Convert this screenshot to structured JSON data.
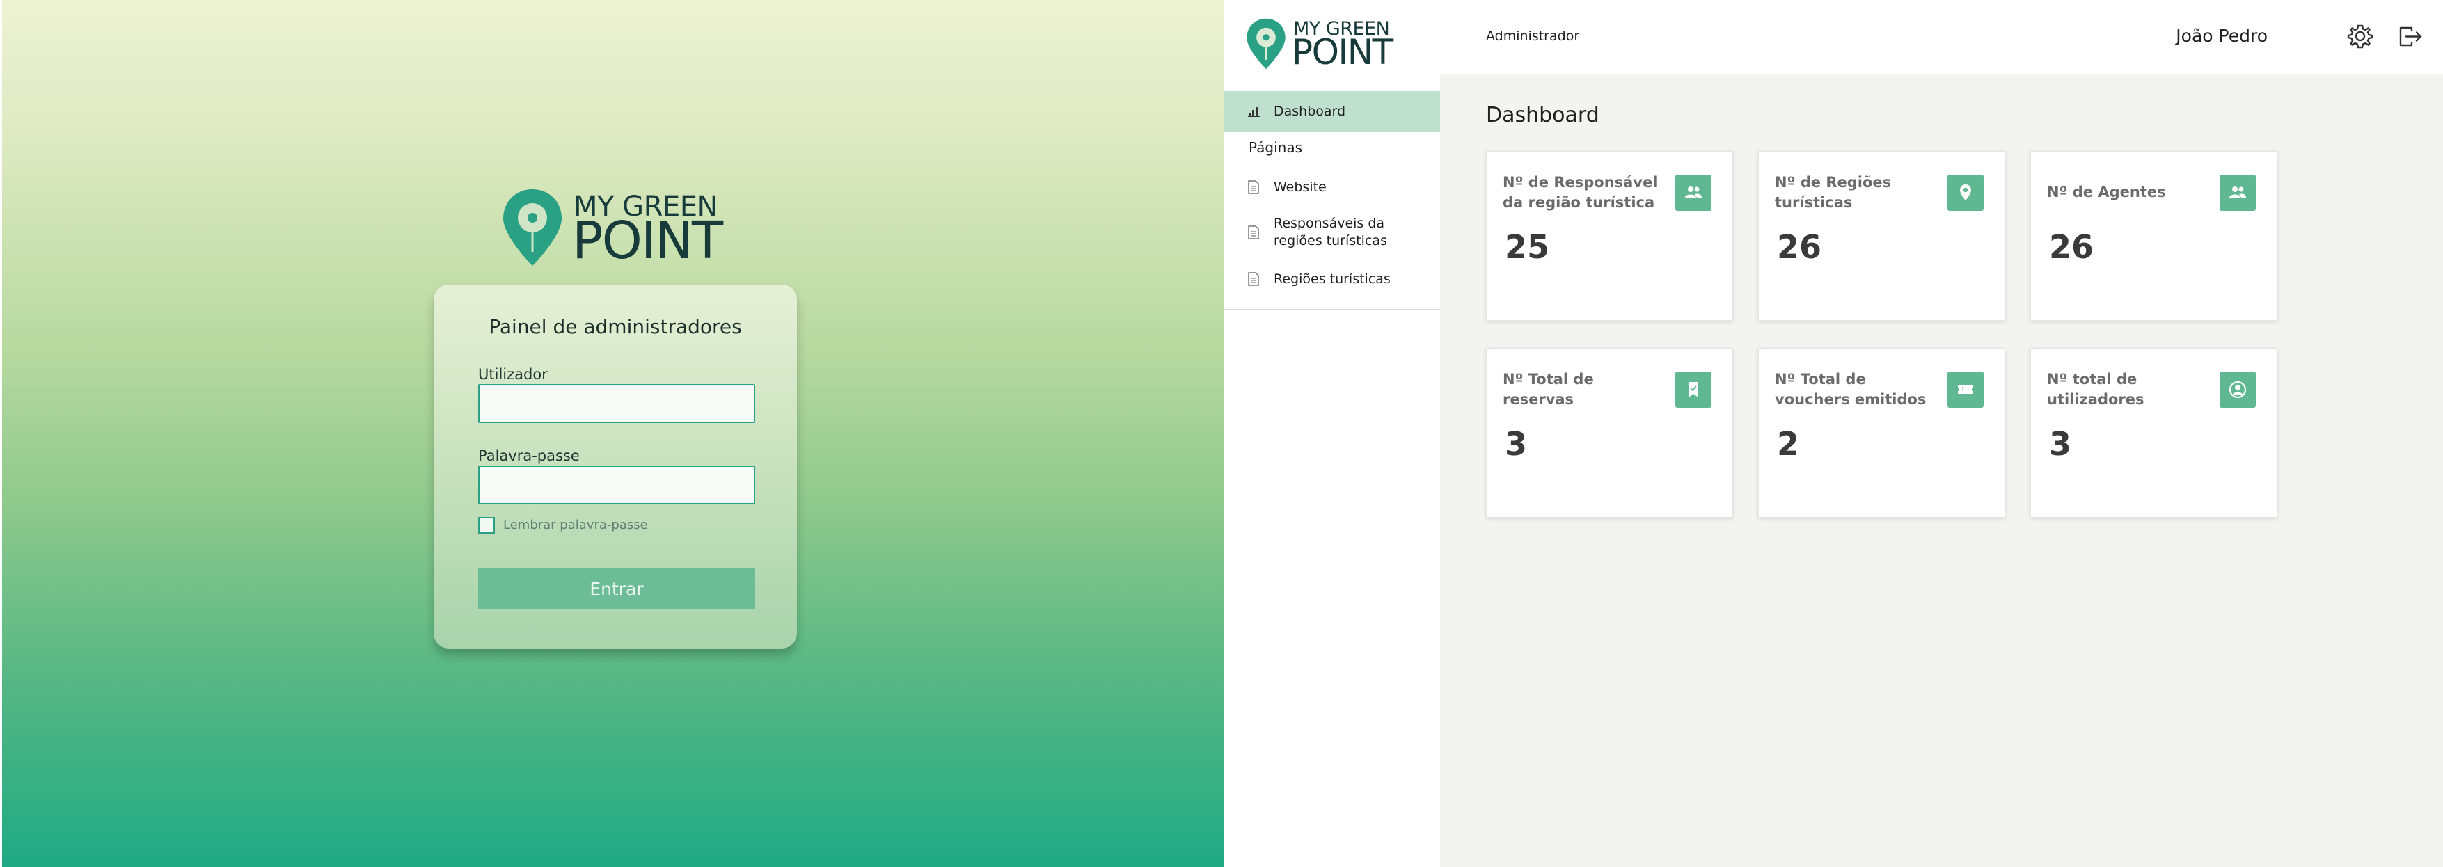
{
  "login": {
    "logo": {
      "top": "MY GREEN",
      "bottom": "POINT"
    },
    "title": "Painel de administradores",
    "username": {
      "label": "Utilizador",
      "value": "",
      "placeholder": ""
    },
    "password": {
      "label": "Palavra-passe",
      "value": "",
      "placeholder": ""
    },
    "remember_label": "Lembrar palavra-passe",
    "submit_label": "Entrar"
  },
  "dashboard": {
    "logo": {
      "top": "MY GREEN",
      "bottom": "POINT"
    },
    "sidebar": {
      "items": [
        {
          "label": "Dashboard",
          "icon": "bar-chart-icon",
          "active": true
        },
        {
          "label": "Website",
          "icon": "document-icon"
        },
        {
          "label": "Responsáveis da regiões turísticas",
          "icon": "document-icon"
        },
        {
          "label": "Regiões turísticas",
          "icon": "document-icon"
        }
      ],
      "section_label": "Páginas"
    },
    "topbar": {
      "role": "Administrador",
      "user": "João Pedro",
      "settings_icon": "gear-icon",
      "logout_icon": "logout-icon"
    },
    "title": "Dashboard",
    "cards": [
      {
        "label": "Nº de Responsável da região turística",
        "value": "25",
        "icon": "group-icon"
      },
      {
        "label": "Nº de Regiões turísticas",
        "value": "26",
        "icon": "location-pin-icon"
      },
      {
        "label": "Nº de Agentes",
        "value": "26",
        "icon": "group-icon"
      },
      {
        "label": "Nº Total de reservas",
        "value": "3",
        "icon": "bookmark-icon"
      },
      {
        "label": "Nº Total de vouchers emitidos",
        "value": "2",
        "icon": "ticket-icon"
      },
      {
        "label": "Nº total de utilizadores",
        "value": "3",
        "icon": "user-circle-icon"
      }
    ]
  },
  "colors": {
    "brand_green": "#2aa184",
    "card_icon_bg": "#5fb892",
    "sidebar_active_bg": "#bfdfcf",
    "logo_text": "#173a3a"
  }
}
